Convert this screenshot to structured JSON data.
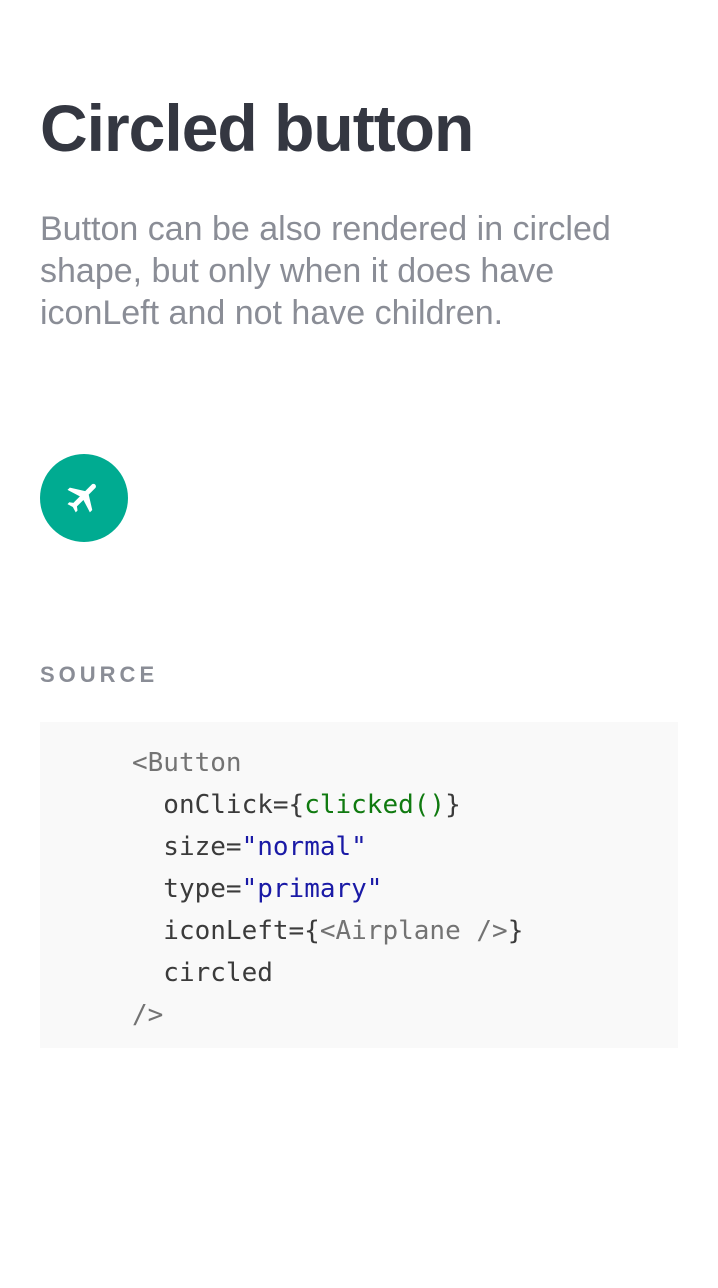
{
  "title": "Circled button",
  "description": "Button can be also rendered in circled shape, but only when it does have iconLeft and not have children.",
  "button": {
    "icon": "airplane-icon",
    "color": "#00ab91"
  },
  "source_label": "SOURCE",
  "code": {
    "open": "<Button",
    "l1a": "  onClick={",
    "l1b": "clicked()",
    "l1c": "}",
    "l2a": "  size=",
    "l2b": "\"normal\"",
    "l3a": "  type=",
    "l3b": "\"primary\"",
    "l4a": "  iconLeft={",
    "l4b": "<Airplane />",
    "l4c": "}",
    "l5": "  circled",
    "close": "/>"
  }
}
